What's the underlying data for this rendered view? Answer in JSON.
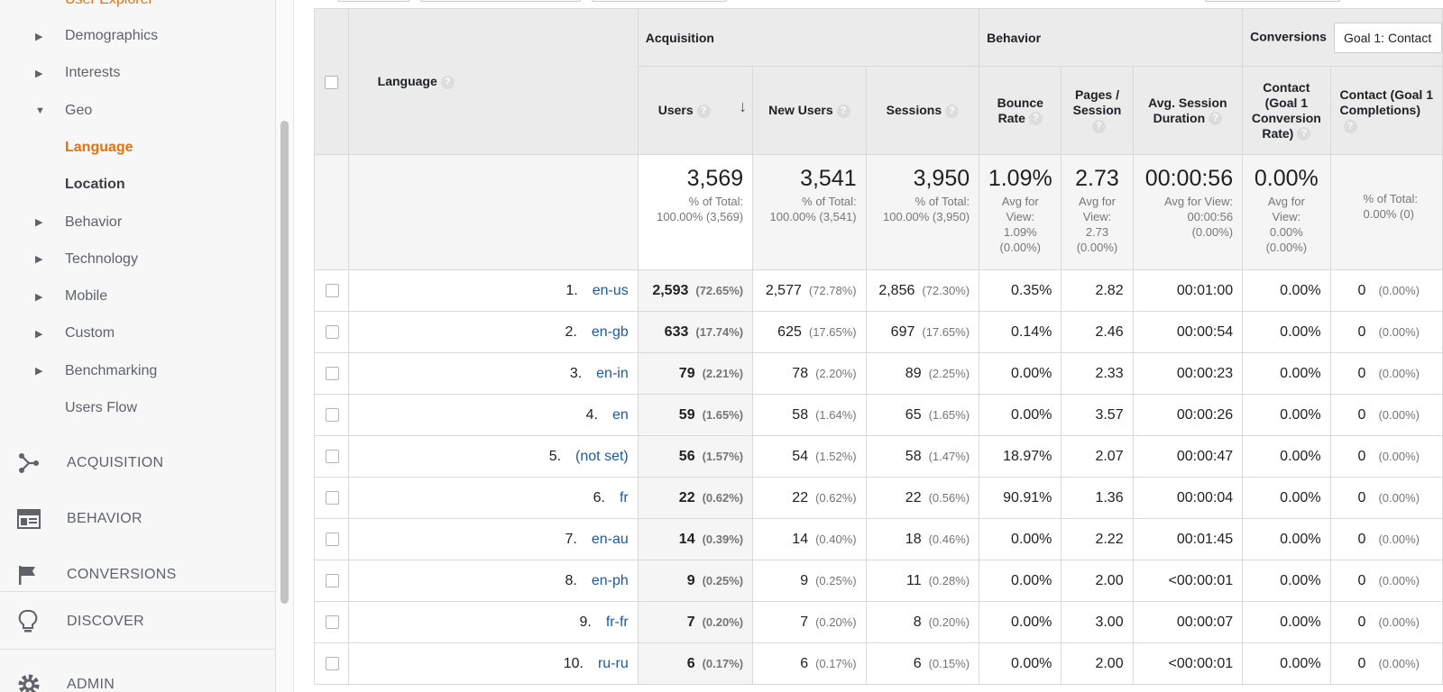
{
  "sidebar": {
    "top_item": "User Explorer",
    "items": [
      {
        "label": "Demographics",
        "expand": "▶",
        "style": "tri"
      },
      {
        "label": "Interests",
        "expand": "▶",
        "style": "tri"
      },
      {
        "label": "Geo",
        "expand": "▼",
        "style": "tri"
      },
      {
        "label": "Language",
        "expand": "",
        "style": "active"
      },
      {
        "label": "Location",
        "expand": "",
        "style": "bold"
      },
      {
        "label": "Behavior",
        "expand": "▶",
        "style": "tri"
      },
      {
        "label": "Technology",
        "expand": "▶",
        "style": "tri"
      },
      {
        "label": "Mobile",
        "expand": "▶",
        "style": "tri"
      },
      {
        "label": "Custom",
        "expand": "▶",
        "style": "tri"
      },
      {
        "label": "Benchmarking",
        "expand": "▶",
        "style": "tri"
      },
      {
        "label": "Users Flow",
        "expand": "",
        "style": "plain"
      }
    ],
    "sections": [
      {
        "label": "ACQUISITION",
        "icon": "acquisition-icon"
      },
      {
        "label": "BEHAVIOR",
        "icon": "behavior-icon"
      },
      {
        "label": "CONVERSIONS",
        "icon": "flag-icon"
      },
      {
        "label": "DISCOVER",
        "icon": "lightbulb-icon"
      },
      {
        "label": "ADMIN",
        "icon": "gear-icon"
      }
    ]
  },
  "table": {
    "dimension_label": "Language",
    "help_glyph": "?",
    "sort_glyph": "↓",
    "groups": {
      "acquisition": "Acquisition",
      "behavior": "Behavior",
      "conversions": "Conversions",
      "goal_select": "Goal 1: Contact"
    },
    "columns": {
      "users": "Users",
      "new_users": "New Users",
      "sessions": "Sessions",
      "bounce_rate": "Bounce Rate",
      "pages_session": "Pages / Session",
      "avg_duration": "Avg. Session Duration",
      "conv_rate": "Contact (Goal 1 Conversion Rate)",
      "completions": "Contact (Goal 1 Completions)"
    },
    "totals": {
      "users": {
        "value": "3,569",
        "sub1": "% of Total:",
        "sub2": "100.00% (3,569)"
      },
      "new_users": {
        "value": "3,541",
        "sub1": "% of Total:",
        "sub2": "100.00% (3,541)"
      },
      "sessions": {
        "value": "3,950",
        "sub1": "% of Total:",
        "sub2": "100.00% (3,950)"
      },
      "bounce_rate": {
        "value": "1.09%",
        "sub1": "Avg for",
        "sub2": "View:",
        "sub3": "1.09%",
        "sub4": "(0.00%)"
      },
      "pages_session": {
        "value": "2.73",
        "sub1": "Avg for",
        "sub2": "View:",
        "sub3": "2.73",
        "sub4": "(0.00%)"
      },
      "avg_duration": {
        "value": "00:00:56",
        "sub1": "Avg for View:",
        "sub2": "00:00:56",
        "sub3": "(0.00%)"
      },
      "conv_rate": {
        "value": "0.00%",
        "sub1": "Avg for",
        "sub2": "View:",
        "sub3": "0.00%",
        "sub4": "(0.00%)"
      },
      "completions": {
        "sub1": "% of Total:",
        "sub2": "0.00% (0)"
      }
    },
    "rows": [
      {
        "n": "1.",
        "lang": "en-us",
        "users": "2,593",
        "users_pct": "(72.65%)",
        "new": "2,577",
        "new_pct": "(72.78%)",
        "sess": "2,856",
        "sess_pct": "(72.30%)",
        "bounce": "0.35%",
        "pages": "2.82",
        "dur": "00:01:00",
        "conv": "0.00%",
        "comp": "0",
        "comp_pct": "(0.00%)"
      },
      {
        "n": "2.",
        "lang": "en-gb",
        "users": "633",
        "users_pct": "(17.74%)",
        "new": "625",
        "new_pct": "(17.65%)",
        "sess": "697",
        "sess_pct": "(17.65%)",
        "bounce": "0.14%",
        "pages": "2.46",
        "dur": "00:00:54",
        "conv": "0.00%",
        "comp": "0",
        "comp_pct": "(0.00%)"
      },
      {
        "n": "3.",
        "lang": "en-in",
        "users": "79",
        "users_pct": "(2.21%)",
        "new": "78",
        "new_pct": "(2.20%)",
        "sess": "89",
        "sess_pct": "(2.25%)",
        "bounce": "0.00%",
        "pages": "2.33",
        "dur": "00:00:23",
        "conv": "0.00%",
        "comp": "0",
        "comp_pct": "(0.00%)"
      },
      {
        "n": "4.",
        "lang": "en",
        "users": "59",
        "users_pct": "(1.65%)",
        "new": "58",
        "new_pct": "(1.64%)",
        "sess": "65",
        "sess_pct": "(1.65%)",
        "bounce": "0.00%",
        "pages": "3.57",
        "dur": "00:00:26",
        "conv": "0.00%",
        "comp": "0",
        "comp_pct": "(0.00%)"
      },
      {
        "n": "5.",
        "lang": "(not set)",
        "users": "56",
        "users_pct": "(1.57%)",
        "new": "54",
        "new_pct": "(1.52%)",
        "sess": "58",
        "sess_pct": "(1.47%)",
        "bounce": "18.97%",
        "pages": "2.07",
        "dur": "00:00:47",
        "conv": "0.00%",
        "comp": "0",
        "comp_pct": "(0.00%)"
      },
      {
        "n": "6.",
        "lang": "fr",
        "users": "22",
        "users_pct": "(0.62%)",
        "new": "22",
        "new_pct": "(0.62%)",
        "sess": "22",
        "sess_pct": "(0.56%)",
        "bounce": "90.91%",
        "pages": "1.36",
        "dur": "00:00:04",
        "conv": "0.00%",
        "comp": "0",
        "comp_pct": "(0.00%)"
      },
      {
        "n": "7.",
        "lang": "en-au",
        "users": "14",
        "users_pct": "(0.39%)",
        "new": "14",
        "new_pct": "(0.40%)",
        "sess": "18",
        "sess_pct": "(0.46%)",
        "bounce": "0.00%",
        "pages": "2.22",
        "dur": "00:01:45",
        "conv": "0.00%",
        "comp": "0",
        "comp_pct": "(0.00%)"
      },
      {
        "n": "8.",
        "lang": "en-ph",
        "users": "9",
        "users_pct": "(0.25%)",
        "new": "9",
        "new_pct": "(0.25%)",
        "sess": "11",
        "sess_pct": "(0.28%)",
        "bounce": "0.00%",
        "pages": "2.00",
        "dur": "<00:00:01",
        "conv": "0.00%",
        "comp": "0",
        "comp_pct": "(0.00%)"
      },
      {
        "n": "9.",
        "lang": "fr-fr",
        "users": "7",
        "users_pct": "(0.20%)",
        "new": "7",
        "new_pct": "(0.20%)",
        "sess": "8",
        "sess_pct": "(0.20%)",
        "bounce": "0.00%",
        "pages": "3.00",
        "dur": "00:00:07",
        "conv": "0.00%",
        "comp": "0",
        "comp_pct": "(0.00%)"
      },
      {
        "n": "10.",
        "lang": "ru-ru",
        "users": "6",
        "users_pct": "(0.17%)",
        "new": "6",
        "new_pct": "(0.17%)",
        "sess": "6",
        "sess_pct": "(0.15%)",
        "bounce": "0.00%",
        "pages": "2.00",
        "dur": "<00:00:01",
        "conv": "0.00%",
        "comp": "0",
        "comp_pct": "(0.00%)"
      }
    ]
  },
  "colors": {
    "accent": "#e8710a",
    "link": "#1a5aa6",
    "header_bg": "#ebebeb"
  }
}
